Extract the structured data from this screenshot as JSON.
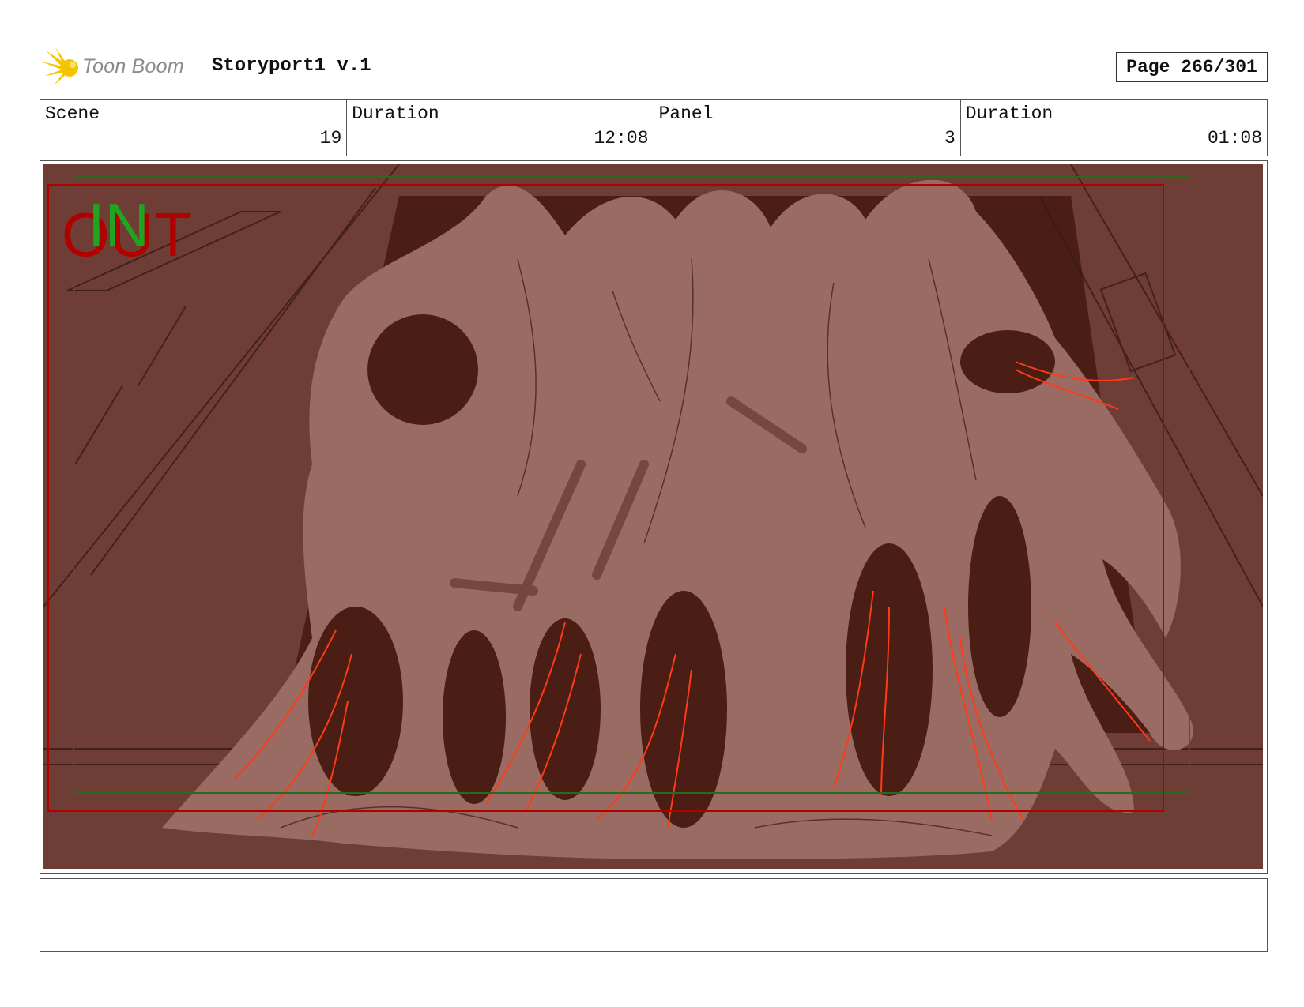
{
  "header": {
    "logo_text": "Toon Boom",
    "project_title": "Storyport1 v.1",
    "page_label": "Page 266/301"
  },
  "info": {
    "scene_label": "Scene",
    "scene_value": "19",
    "scene_duration_label": "Duration",
    "scene_duration_value": "12:08",
    "panel_label": "Panel",
    "panel_value": "3",
    "panel_duration_label": "Duration",
    "panel_duration_value": "01:08"
  },
  "panel": {
    "in_marker": "IN",
    "out_marker": "OUT",
    "colors": {
      "background": "#6e3d36",
      "dark": "#4a1d15",
      "creature": "#9a6b63",
      "line": "#3a1a14",
      "accent": "#ff3a16",
      "safe_frame": "#b00000",
      "action_frame": "#2a6a1a"
    }
  },
  "notes": {
    "text": ""
  }
}
